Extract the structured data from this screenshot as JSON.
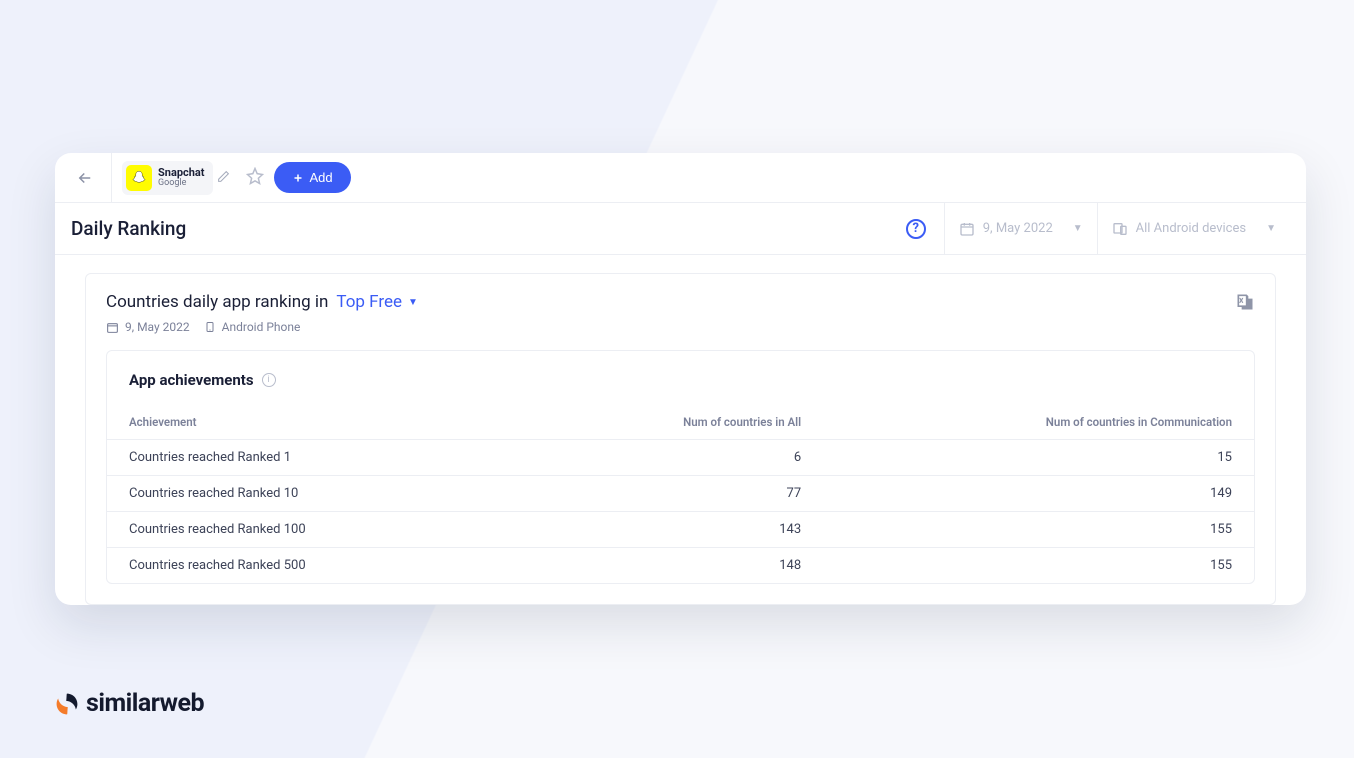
{
  "topbar": {
    "app_name": "Snapchat",
    "app_publisher": "Google",
    "add_label": "Add"
  },
  "page": {
    "title": "Daily Ranking",
    "date_filter": "9, May 2022",
    "device_filter": "All Android devices"
  },
  "panel": {
    "title_prefix": "Countries daily app ranking in",
    "category": "Top Free",
    "meta_date": "9, May 2022",
    "meta_device": "Android Phone"
  },
  "achievements": {
    "title": "App achievements",
    "columns": [
      "Achievement",
      "Num of countries in All",
      "Num of countries in Communication"
    ],
    "rows": [
      {
        "label": "Countries reached Ranked 1",
        "all": "6",
        "comm": "15"
      },
      {
        "label": "Countries reached Ranked 10",
        "all": "77",
        "comm": "149"
      },
      {
        "label": "Countries reached Ranked 100",
        "all": "143",
        "comm": "155"
      },
      {
        "label": "Countries reached Ranked 500",
        "all": "148",
        "comm": "155"
      }
    ]
  },
  "brand": "similarweb",
  "chart_data": {
    "type": "table",
    "title": "App achievements — Countries daily app ranking in Top Free (9 May 2022, Android Phone)",
    "columns": [
      "Achievement",
      "Num of countries in All",
      "Num of countries in Communication"
    ],
    "rows": [
      [
        "Countries reached Ranked 1",
        6,
        15
      ],
      [
        "Countries reached Ranked 10",
        77,
        149
      ],
      [
        "Countries reached Ranked 100",
        143,
        155
      ],
      [
        "Countries reached Ranked 500",
        148,
        155
      ]
    ]
  }
}
